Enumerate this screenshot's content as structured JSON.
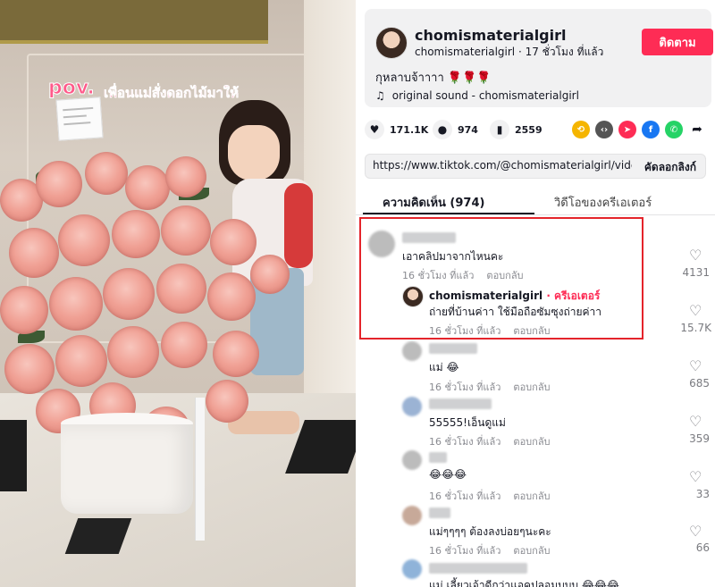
{
  "photo": {
    "overlay_pov": "pov.",
    "overlay_thai": "เพื่อนแม่สั่งดอกไม้มาให้"
  },
  "post": {
    "username": "chomismaterialgirl",
    "handle": "chomismaterialgirl",
    "time_ago": "17 ชั่วโมง ที่แล้ว",
    "follow_label": "ติดตาม",
    "caption": "กุหลาบจ้าาาา 🌹🌹🌹",
    "sound": "original sound - chomismaterialgirl",
    "likes": "171.1K",
    "comments": "974",
    "saves": "2559",
    "link": "https://www.tiktok.com/@chomismaterialgirl/video/7...",
    "copy_link_label": "คัดลอกลิงก์"
  },
  "tabs": {
    "comments": "ความคิดเห็น (974)",
    "creator_videos": "วิดีโอของครีเอเตอร์"
  },
  "comments": [
    {
      "text": "เอาคลิปมาจากไหนคะ",
      "time": "16 ชั่วโมง ที่แล้ว",
      "reply": "ตอบกลับ",
      "likes": "4131"
    },
    {
      "creator_name": "chomismaterialgirl",
      "creator_badge": "· ครีเอเตอร์",
      "text": "ถ่ายที่บ้านค่าา ใช้มือถือซัมซุงถ่ายค่าา",
      "time": "16 ชั่วโมง ที่แล้ว",
      "reply": "ตอบกลับ",
      "likes": "15.7K"
    },
    {
      "text": "แม่ 😂",
      "time": "16 ชั่วโมง ที่แล้ว",
      "reply": "ตอบกลับ",
      "likes": "685"
    },
    {
      "text": "55555!เอ็นดูแม่",
      "time": "16 ชั่วโมง ที่แล้ว",
      "reply": "ตอบกลับ",
      "likes": "359"
    },
    {
      "text": "😂😂😂",
      "time": "16 ชั่วโมง ที่แล้ว",
      "reply": "ตอบกลับ",
      "likes": "33"
    },
    {
      "text": "แม่ๆๆๆๆ ต้องลงบ่อยๆนะคะ",
      "time": "16 ชั่วโมง ที่แล้ว",
      "reply": "ตอบกลับ",
      "likes": "66"
    },
    {
      "text": "แม่ เลี้ยวเจ้าดีกว่าแอคปลอมบบบ 😂😂😂"
    }
  ],
  "colors": {
    "accent": "#fe2c55",
    "highlight_border": "#e4242b"
  }
}
